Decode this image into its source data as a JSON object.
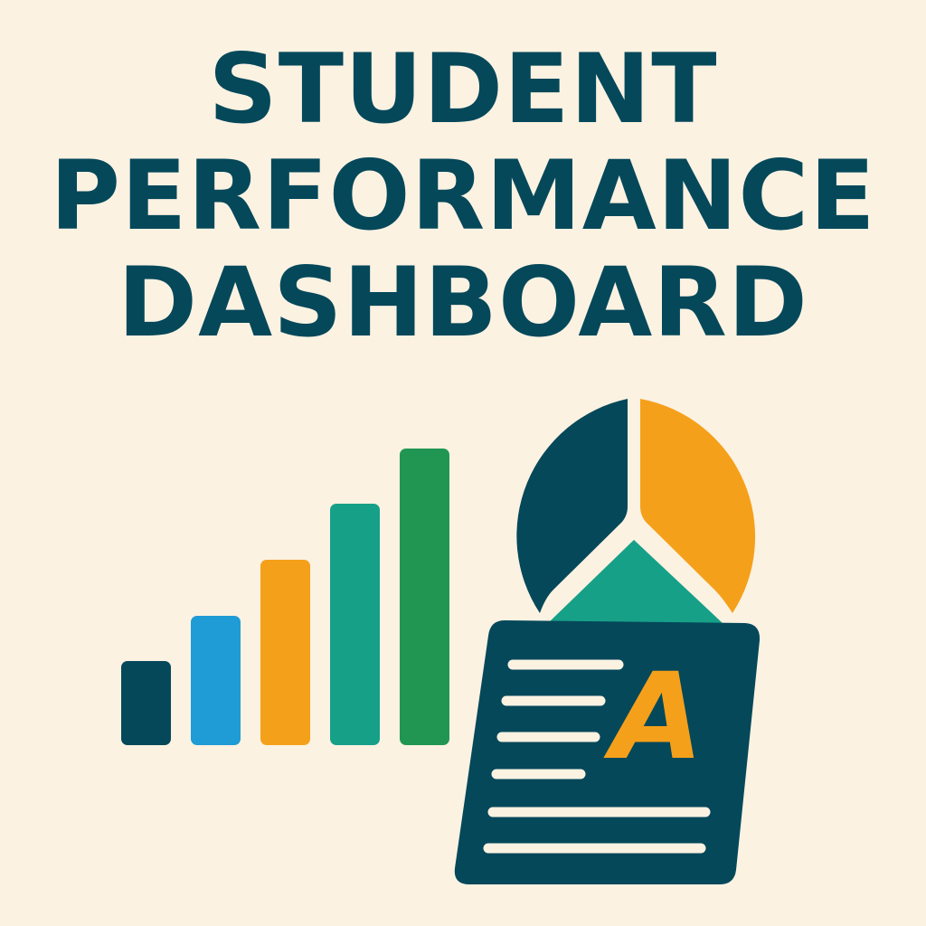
{
  "title": {
    "lines": [
      "STUDENT",
      "PERFORMANCE",
      "DASHBOARD"
    ]
  },
  "report_card": {
    "grade": "A"
  },
  "colors": {
    "background": "#fbf2e2",
    "navy": "#05485a",
    "blue": "#1f9bd5",
    "orange": "#f5a01a",
    "teal": "#17a088",
    "green": "#219652",
    "line": "#fbf2e2"
  },
  "icons": [
    "bar-chart-icon",
    "pie-chart-icon",
    "report-card-icon"
  ]
}
